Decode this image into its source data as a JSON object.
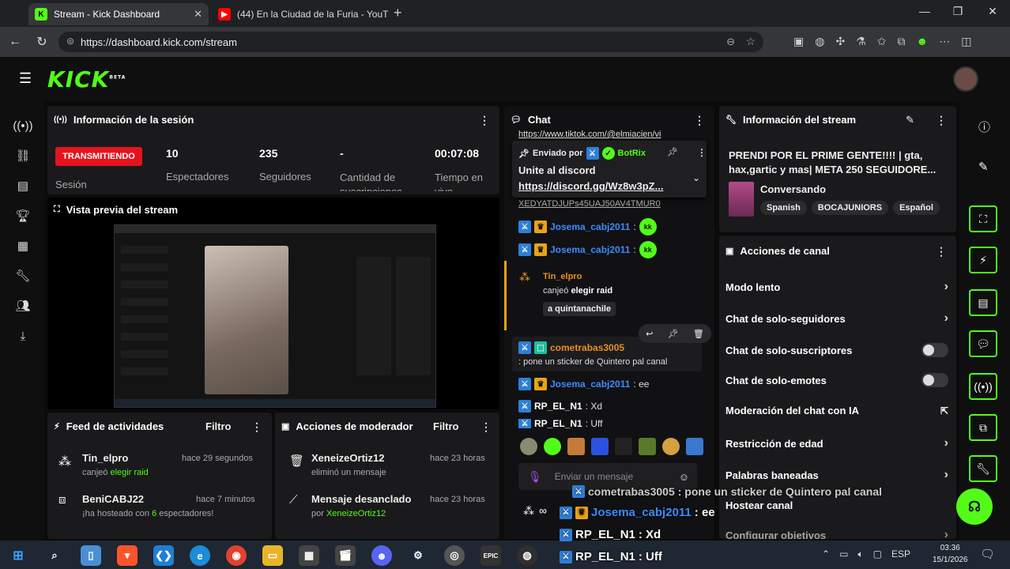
{
  "browser": {
    "tabs": [
      {
        "title": "Stream - Kick Dashboard",
        "icon": "K"
      },
      {
        "title": "(44) En la Ciudad de la Furia - YouT",
        "icon": "▶"
      }
    ],
    "url": "https://dashboard.kick.com/stream"
  },
  "app": {
    "logo": "KICK",
    "logo_sup": "BETA"
  },
  "session": {
    "title": "Información de la sesión",
    "live_label": "TRANSMITIENDO",
    "session_label": "Sesión",
    "stats": [
      {
        "value": "10",
        "label": "Espectadores"
      },
      {
        "value": "235",
        "label": "Seguidores"
      },
      {
        "value": "-",
        "label": "Cantidad de suscripciones"
      },
      {
        "value": "00:07:08",
        "label": "Tiempo en vivo"
      }
    ]
  },
  "preview": {
    "title": "Vista previa del stream"
  },
  "activity": {
    "title": "Feed de actividades",
    "filter": "Filtro",
    "items": [
      {
        "user": "Tin_elpro",
        "time": "hace 29 segundos",
        "prefix": "canjeó ",
        "highlight": "elegir raid",
        "suffix": ""
      },
      {
        "user": "BeniCABJ22",
        "time": "hace 7 minutos",
        "prefix": "¡ha hosteado con ",
        "highlight": "6",
        "suffix": " espectadores!"
      }
    ]
  },
  "modactions": {
    "title": "Acciones de moderador",
    "filter": "Filtro",
    "items": [
      {
        "user": "XeneizeOrtiz12",
        "time": "hace 23 horas",
        "prefix": "eliminó un mensaje",
        "highlight": ""
      },
      {
        "user": "Mensaje desanclado",
        "time": "hace 23 horas",
        "prefix": "por ",
        "highlight": "XeneizeOrtiz12"
      }
    ]
  },
  "chat": {
    "title": "Chat",
    "top_cut": "https://www.tiktok.com/@elmiacien/vi",
    "pinned": {
      "sent_by": "Enviado por",
      "bot": "BotRix",
      "text": "Unite al discord",
      "link": "https://discord.gg/Wz8w3pZ..."
    },
    "cut_line": "XEDYATDJUPs45UAJ50AV4TMUR0",
    "messages": [
      {
        "user": "Josema_cabj2011",
        "text": "",
        "emote": "kk"
      },
      {
        "user": "Josema_cabj2011",
        "text": "",
        "emote": "kk"
      }
    ],
    "redeem": {
      "user": "Tin_elpro",
      "action": "canjeó",
      "reward": "elegir raid",
      "extra": "a quintanachile"
    },
    "msg2": {
      "user": "cometrabas3005",
      "text": ": pone un sticker de Quintero pal canal"
    },
    "msg3": {
      "user": "Josema_cabj2011",
      "text": ": ee"
    },
    "msg4": {
      "user": "RP_EL_N1",
      "text": ": Xd"
    },
    "msg5": {
      "user": "RP_EL_N1",
      "text": ": Uff"
    },
    "input_placeholder": "Enviar un mensaje"
  },
  "streaminfo": {
    "title": "Información del stream",
    "stream_title": "PRENDI POR EL PRIME GENTE!!!! | gta, hax,gartic y mas| META 250 SEGUIDORE...",
    "category": "Conversando",
    "tags": [
      "Spanish",
      "BOCAJUNIORS",
      "Español"
    ]
  },
  "channelactions": {
    "title": "Acciones de canal",
    "items": [
      {
        "label": "Modo lento",
        "control": "chevron"
      },
      {
        "label": "Chat de solo-seguidores",
        "control": "chevron"
      },
      {
        "label": "Chat de solo-suscriptores",
        "control": "toggle"
      },
      {
        "label": "Chat de solo-emotes",
        "control": "toggle"
      },
      {
        "label": "Moderación del chat con IA",
        "control": "external"
      },
      {
        "label": "Restricción de edad",
        "control": "chevron"
      },
      {
        "label": "Palabras baneadas",
        "control": "chevron"
      },
      {
        "label": "Hostear canal",
        "control": "none"
      },
      {
        "label": "Configurar objetivos",
        "control": "chevron"
      }
    ]
  },
  "overlay": {
    "lines": [
      {
        "user": "cometrabas3005",
        "text": " : pone un sticker de Quintero pal canal"
      },
      {
        "user": "Josema_cabj2011",
        "text": " : ee"
      },
      {
        "user": "RP_EL_N1",
        "text": " : Xd"
      },
      {
        "user": "RP_EL_N1",
        "text": " : Uff"
      }
    ]
  },
  "taskbar": {
    "lang": "ESP",
    "time": "03:36",
    "date": "15/1/2026"
  },
  "colors": {
    "accent": "#53fc18",
    "live": "#e4141e",
    "panel": "#1a1a1c"
  }
}
